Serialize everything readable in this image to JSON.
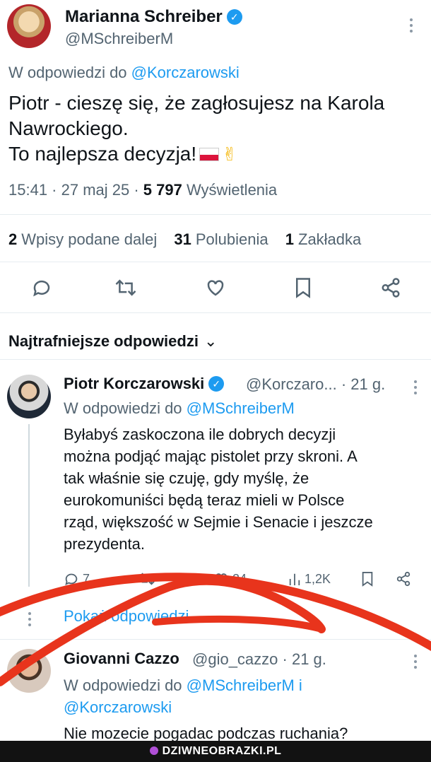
{
  "main_tweet": {
    "author_name": "Marianna Schreiber",
    "author_handle": "@MSchreiberM",
    "reply_prefix": "W odpowiedzi do",
    "reply_to": "@Korczarowski",
    "text_line1": "Piotr - cieszę się, że zagłosujesz na Karola",
    "text_line2": "Nawrockiego.",
    "text_line3": "To najlepsza decyzja!",
    "time": "15:41 · 27 maj 25 ·",
    "views_count": "5 797",
    "views_label": "Wyświetlenia",
    "retweets_count": "2",
    "retweets_label": "Wpisy podane dalej",
    "likes_count": "31",
    "likes_label": "Polubienia",
    "bookmarks_count": "1",
    "bookmarks_label": "Zakładka"
  },
  "replies_section": {
    "title": "Najtrafniejsze odpowiedzi"
  },
  "reply1": {
    "author_name": "Piotr Korczarowski",
    "author_handle": "@Korczaro...",
    "age": "· 21 g.",
    "reply_prefix": "W odpowiedzi do",
    "reply_to": "@MSchreiberM",
    "text_line1": "Byłabyś zaskoczona ile dobrych decyzji",
    "text_line2": "można podjąć mając pistolet przy skroni. A",
    "text_line3": "tak właśnie się czuję, gdy myślę, że",
    "text_line4": "eurokomuniści będą teraz mieli w Polsce",
    "text_line5": "rząd, większość w Sejmie i Senacie i jeszcze",
    "text_line6": "prezydenta.",
    "replies_count": "7",
    "likes_count": "24",
    "views_count": "1,2K",
    "show_replies": "Pokaż odpowiedzi"
  },
  "reply2": {
    "author_name": "Giovanni Cazzo",
    "author_handle": "@gio_cazzo",
    "age": "· 21 g.",
    "reply_prefix": "W odpowiedzi do",
    "reply_to_line1": "@MSchreiberM i",
    "reply_to_line2": "@Korczarowski",
    "text_line1": "Nie mozecie pogadac podczas ruchania?"
  },
  "watermark": {
    "text": "DZIWNEOBRAZKI.PL"
  },
  "colors": {
    "accent": "#1d9bf0",
    "secondary_text": "#536471",
    "scribble": "#e8341c"
  }
}
